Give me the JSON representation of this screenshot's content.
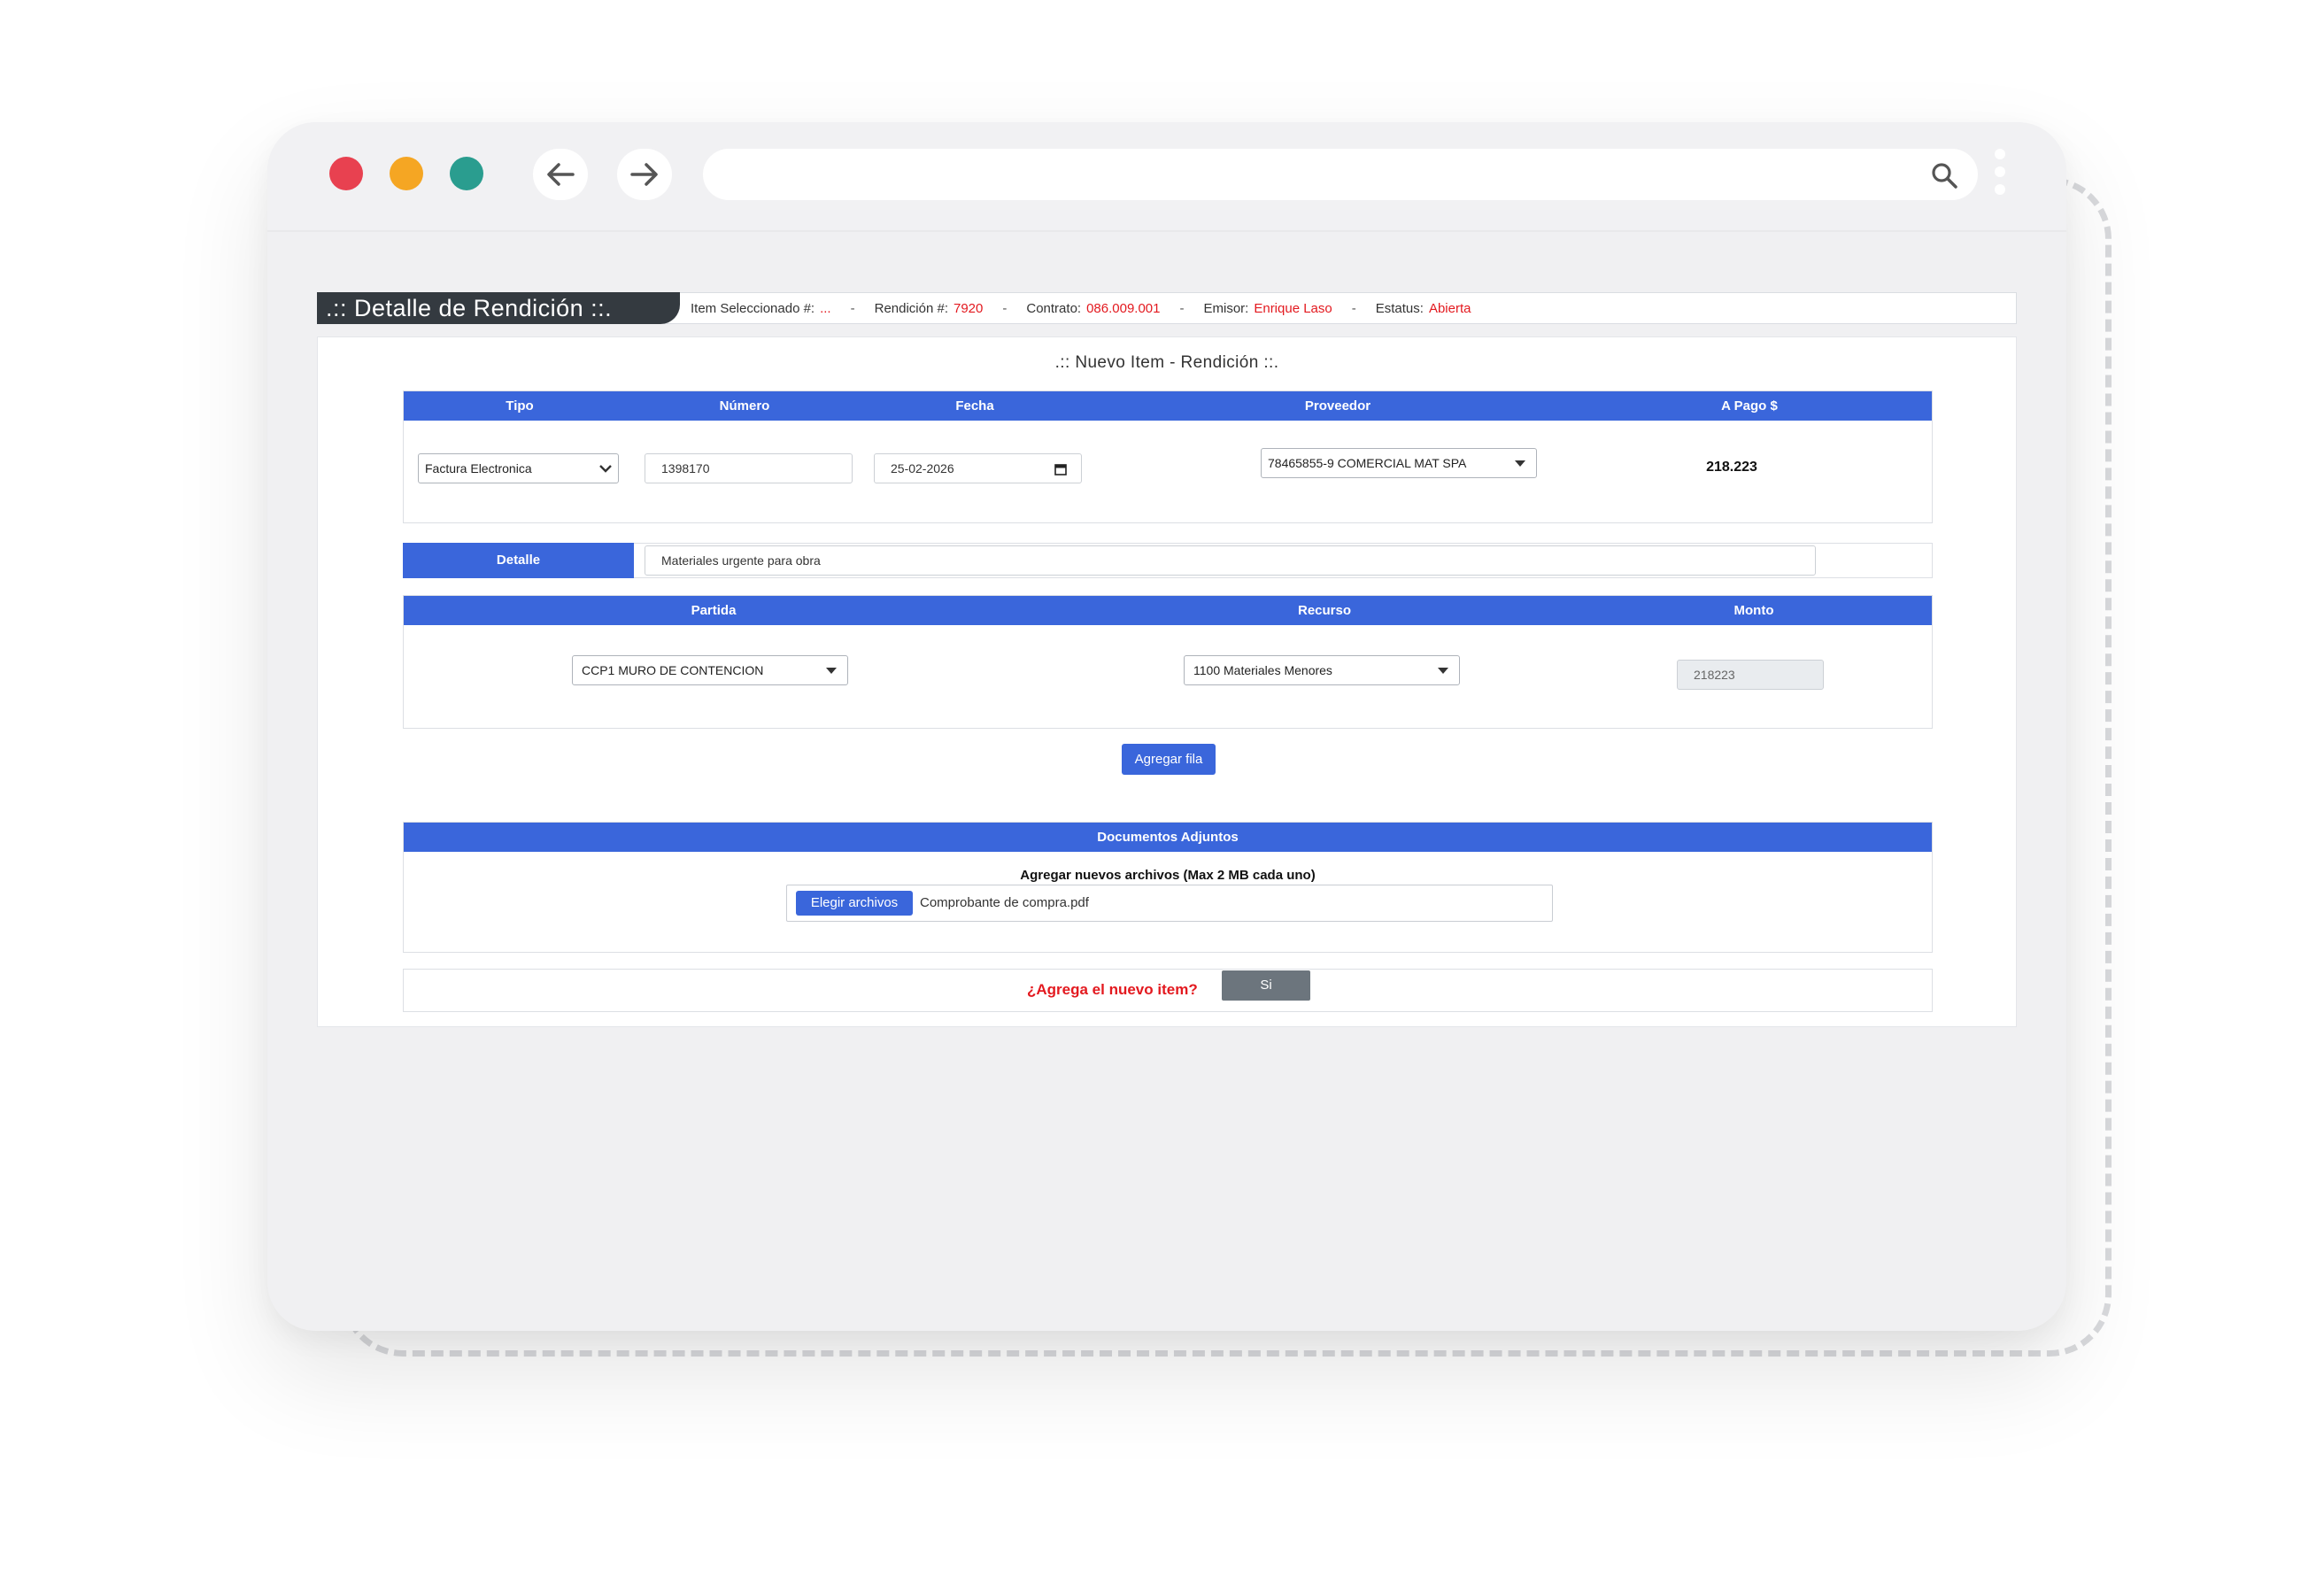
{
  "header": {
    "title": ".:: Detalle de Rendición ::.",
    "item_label": "Item Seleccionado #:",
    "item_value": "...",
    "rendicion_label": "Rendición #:",
    "rendicion_value": "7920",
    "contrato_label": "Contrato:",
    "contrato_value": "086.009.001",
    "emisor_label": "Emisor:",
    "emisor_value": "Enrique Laso",
    "estatus_label": "Estatus:",
    "estatus_value": "Abierta",
    "separator": "-"
  },
  "card": {
    "title": ".:: Nuevo Item - Rendición ::."
  },
  "item_table": {
    "headers": {
      "tipo": "Tipo",
      "numero": "Número",
      "fecha": "Fecha",
      "proveedor": "Proveedor",
      "a_pago": "A Pago $"
    },
    "tipo_value": "Factura Electronica",
    "numero_value": "1398170",
    "fecha_value": "25-02-2026",
    "proveedor_value": "78465855-9 COMERCIAL MAT SPA",
    "a_pago_value": "218.223"
  },
  "detalle": {
    "label": "Detalle",
    "value": "Materiales urgente para obra"
  },
  "partida_table": {
    "headers": {
      "partida": "Partida",
      "recurso": "Recurso",
      "monto": "Monto"
    },
    "partida_value": "CCP1 MURO DE CONTENCION",
    "recurso_value": "1100 Materiales Menores",
    "monto_value": "218223"
  },
  "add_row_label": "Agregar fila",
  "documents": {
    "header": "Documentos Adjuntos",
    "subtitle": "Agregar nuevos archivos (Max 2 MB cada uno)",
    "choose_label": "Elegir archivos",
    "file_name": "Comprobante de compra.pdf"
  },
  "confirm": {
    "question": "¿Agrega el nuevo item?",
    "yes_label": "Si"
  },
  "colors": {
    "primary": "#3a66db",
    "dark": "#343a40",
    "danger": "#e3191f",
    "secondary": "#6c757d"
  }
}
